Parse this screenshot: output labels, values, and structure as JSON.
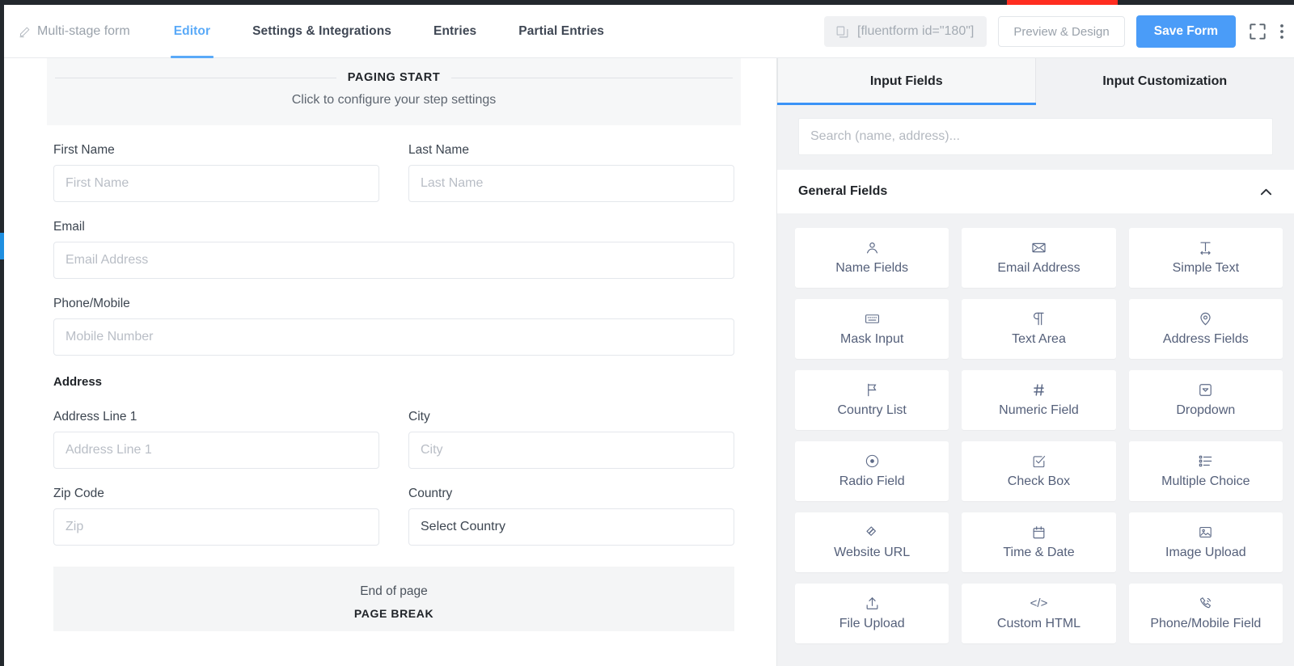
{
  "theme": {
    "accent": "#4a9cf8",
    "tab_active": "#5aaaf8",
    "panel_bg": "#f1f2f4",
    "adminbar": "#23282d",
    "loadbar": "#ff2d20",
    "card_text": "#55607a"
  },
  "header": {
    "form_name": "Multi-stage form",
    "edit_icon": "pencil-icon",
    "tabs": [
      {
        "label": "Editor",
        "active": true
      },
      {
        "label": "Settings & Integrations",
        "active": false
      },
      {
        "label": "Entries",
        "active": false
      },
      {
        "label": "Partial Entries",
        "active": false
      }
    ],
    "shortcode": "[fluentform id=\"180\"]",
    "shortcode_icon": "copy-icon",
    "preview_label": "Preview & Design",
    "save_label": "Save Form",
    "fullscreen_icon": "fullscreen-icon",
    "more_icon": "vertical-dots-icon"
  },
  "canvas": {
    "page_start": {
      "title": "PAGING START",
      "subtitle": "Click to configure your step settings"
    },
    "fields": [
      {
        "label": "First Name",
        "placeholder": "First Name",
        "half": true
      },
      {
        "label": "Last Name",
        "placeholder": "Last Name",
        "half": true
      },
      {
        "label": "Email",
        "placeholder": "Email Address",
        "half": false
      },
      {
        "label": "Phone/Mobile",
        "placeholder": "Mobile Number",
        "half": false
      }
    ],
    "address": {
      "group_label": "Address",
      "line1": {
        "label": "Address Line 1",
        "placeholder": "Address Line 1"
      },
      "city": {
        "label": "City",
        "placeholder": "City"
      },
      "zip": {
        "label": "Zip Code",
        "placeholder": "Zip"
      },
      "country": {
        "label": "Country",
        "value": "Select Country"
      }
    },
    "page_end": {
      "title": "End of page",
      "subtitle": "PAGE BREAK"
    }
  },
  "panel": {
    "tabs": [
      {
        "label": "Input Fields",
        "active": true
      },
      {
        "label": "Input Customization",
        "active": false
      }
    ],
    "search": {
      "placeholder": "Search (name, address)..."
    },
    "section": {
      "title": "General Fields",
      "collapse_icon": "chevron-up-icon"
    },
    "cards": [
      {
        "label": "Name Fields",
        "icon": "user-icon"
      },
      {
        "label": "Email Address",
        "icon": "envelope-icon"
      },
      {
        "label": "Simple Text",
        "icon": "text-width-icon"
      },
      {
        "label": "Mask Input",
        "icon": "keyboard-icon"
      },
      {
        "label": "Text Area",
        "icon": "paragraph-icon"
      },
      {
        "label": "Address Fields",
        "icon": "map-pin-icon"
      },
      {
        "label": "Country List",
        "icon": "flag-icon"
      },
      {
        "label": "Numeric Field",
        "icon": "hash-icon"
      },
      {
        "label": "Dropdown",
        "icon": "dropdown-icon"
      },
      {
        "label": "Radio Field",
        "icon": "radio-icon"
      },
      {
        "label": "Check Box",
        "icon": "checkbox-icon"
      },
      {
        "label": "Multiple Choice",
        "icon": "list-icon"
      },
      {
        "label": "Website URL",
        "icon": "link-icon"
      },
      {
        "label": "Time & Date",
        "icon": "calendar-icon"
      },
      {
        "label": "Image Upload",
        "icon": "image-icon"
      },
      {
        "label": "File Upload",
        "icon": "upload-icon"
      },
      {
        "label": "Custom HTML",
        "icon": "code-icon"
      },
      {
        "label": "Phone/Mobile Field",
        "icon": "phone-icon"
      }
    ]
  }
}
